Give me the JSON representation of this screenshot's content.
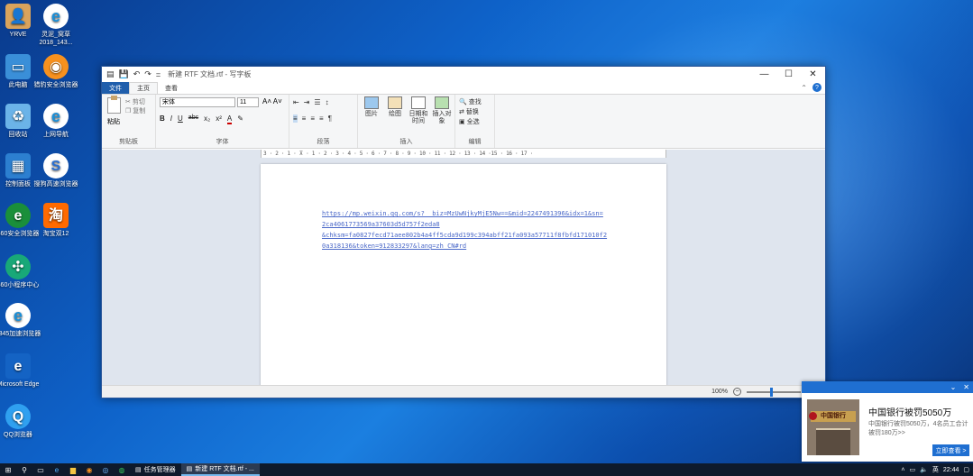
{
  "desktop": {
    "icons": [
      {
        "label": "YRVE",
        "icon": "user-folder-icon"
      },
      {
        "label": "灵泥_窝草 2018_143...",
        "icon": "ie-icon"
      },
      {
        "label": "此电脑",
        "icon": "computer-icon"
      },
      {
        "label": "猎豹安全浏览器",
        "icon": "browser-icon"
      },
      {
        "label": "回收站",
        "icon": "recycle-bin-icon"
      },
      {
        "label": "上网导航",
        "icon": "ie-icon"
      },
      {
        "label": "控制面板",
        "icon": "control-panel-icon"
      },
      {
        "label": "搜狗高速浏览器",
        "icon": "sogou-icon"
      },
      {
        "label": "360安全浏览器",
        "icon": "360-icon"
      },
      {
        "label": "淘宝双12",
        "icon": "taobao-icon"
      },
      {
        "label": "360小程序中心",
        "icon": "mini-program-icon"
      },
      {
        "label": "2345加速浏览器",
        "icon": "ie-icon"
      },
      {
        "label": "Microsoft Edge",
        "icon": "edge-icon"
      },
      {
        "label": "QQ浏览器",
        "icon": "qq-browser-icon"
      }
    ]
  },
  "window": {
    "title": "新建 RTF 文档.rtf - 写字板",
    "controls": {
      "minimize": "—",
      "maximize": "☐",
      "close": "✕"
    },
    "qat": [
      "💾",
      "↶",
      "↷",
      "="
    ],
    "tabs": {
      "file": "文件",
      "home": "主页",
      "view": "查看"
    },
    "ribbon": {
      "clipboard": {
        "paste": "粘贴",
        "cut": "剪切",
        "copy": "复制",
        "label": "剪贴板"
      },
      "font": {
        "name": "宋体",
        "size": "11",
        "label": "字体",
        "buttons": [
          "B",
          "I",
          "U",
          "abc",
          "x₂",
          "x²",
          "A",
          "✎"
        ]
      },
      "paragraph": {
        "label": "段落"
      },
      "insert": {
        "picture": "图片",
        "paint": "绘图",
        "datetime": "日期和时间",
        "object": "插入对象",
        "label": "插入"
      },
      "editing": {
        "find": "查找",
        "replace": "替换",
        "select_all": "全选",
        "label": "编辑"
      }
    },
    "ruler_text": "3 · 2 · 1 · ⊼ · 1 · 2 · 3 · 4 · 5 · 6 · 7 · 8 · 9 · 10 · 11 · 12 · 13 · 14 ·15 · 16 · 17 ·",
    "document": {
      "lines": [
        "https://mp.weixin.qq.com/s?__biz=MzUwNjkyMjE5Nw==&mid=2247491396&idx=1&sn=",
        "2ca4061773569a37603d5d757f2eda8",
        "&chksm=fa0827fecd71aee802b4a4ff5cda9d199c394abff21fa093a57711f8fbfd171010f2",
        "0a318136&token=912833297&lang=zh_CN#rd"
      ]
    },
    "status": {
      "zoom": "100%"
    }
  },
  "notification": {
    "title": "中国银行被罚5050万",
    "body": "中国银行被罚5050万，4名员工合计被罚180万>>",
    "button": "立即查看 >",
    "sign_text": "中国银行"
  },
  "taskbar": {
    "apps": [
      {
        "label": "任务管理器"
      },
      {
        "label": "新建 RTF 文档.rtf - ..."
      }
    ],
    "tray": {
      "lang": "英",
      "time": "22:44"
    }
  }
}
